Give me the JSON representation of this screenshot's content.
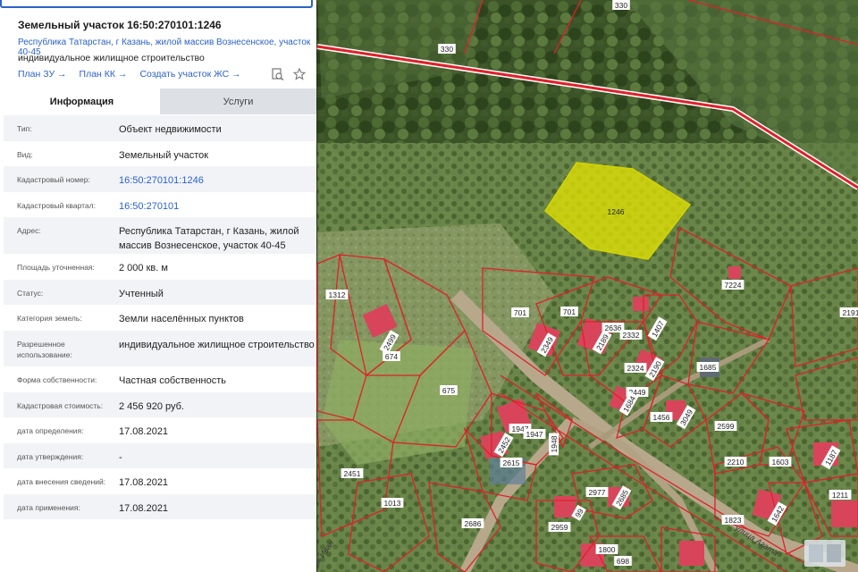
{
  "panel": {
    "title": "Земельный участок 16:50:270101:1246",
    "address": "Республика Татарстан, г Казань, жилой массив Вознесенское, участок 40-45",
    "purpose": "индивидуальное жилищное строительство",
    "links": [
      "План ЗУ →",
      "План КК →",
      "Создать участок ЖС →"
    ],
    "tabs": [
      "Информация",
      "Услуги"
    ],
    "fields": [
      {
        "label": "Тип:",
        "value": "Объект недвижимости"
      },
      {
        "label": "Вид:",
        "value": "Земельный участок"
      },
      {
        "label": "Кадастровый номер:",
        "value": "16:50:270101:1246",
        "link": true
      },
      {
        "label": "Кадастровый квартал:",
        "value": "16:50:270101",
        "link": true
      },
      {
        "label": "Адрес:",
        "value": "Республика Татарстан, г Казань, жилой массив Вознесенское, участок 40-45"
      },
      {
        "label": "Площадь уточненная:",
        "value": "2 000 кв. м"
      },
      {
        "label": "Статус:",
        "value": "Учтенный"
      },
      {
        "label": "Категория земель:",
        "value": "Земли населённых пунктов"
      },
      {
        "label": "Разрешенное использование:",
        "value": "индивидуальное жилищное строительство"
      },
      {
        "label": "Форма собственности:",
        "value": "Частная собственность"
      },
      {
        "label": "Кадастровая стоимость:",
        "value": "2 456 920 руб."
      },
      {
        "label": "дата определения:",
        "value": "17.08.2021"
      },
      {
        "label": "дата утверждения:",
        "value": "-"
      },
      {
        "label": "дата внесения сведений:",
        "value": "17.08.2021"
      },
      {
        "label": "дата применения:",
        "value": "17.08.2021"
      }
    ]
  },
  "map": {
    "selected_plot": "1246",
    "plot_labels": [
      "330",
      "330",
      "1312",
      "2499",
      "674",
      "675",
      "701",
      "701",
      "2636",
      "2349",
      "2189",
      "2332",
      "1407",
      "7224",
      "2191",
      "2324",
      "2190",
      "2449",
      "1684",
      "1685",
      "1456",
      "3049",
      "2599",
      "1947",
      "1947",
      "1948",
      "2615",
      "2452",
      "2451",
      "1013",
      "2686",
      "2977",
      "2685",
      "2959",
      "99",
      "1800",
      "698",
      "2210",
      "1603",
      "1187",
      "1211",
      "1823",
      "1642"
    ],
    "street_name": "улица Агата",
    "street_name_2": "ок Иван"
  },
  "colors": {
    "accent": "#2a62c9",
    "boundary": "#e0202a",
    "selected_fill": "#e6e600"
  }
}
